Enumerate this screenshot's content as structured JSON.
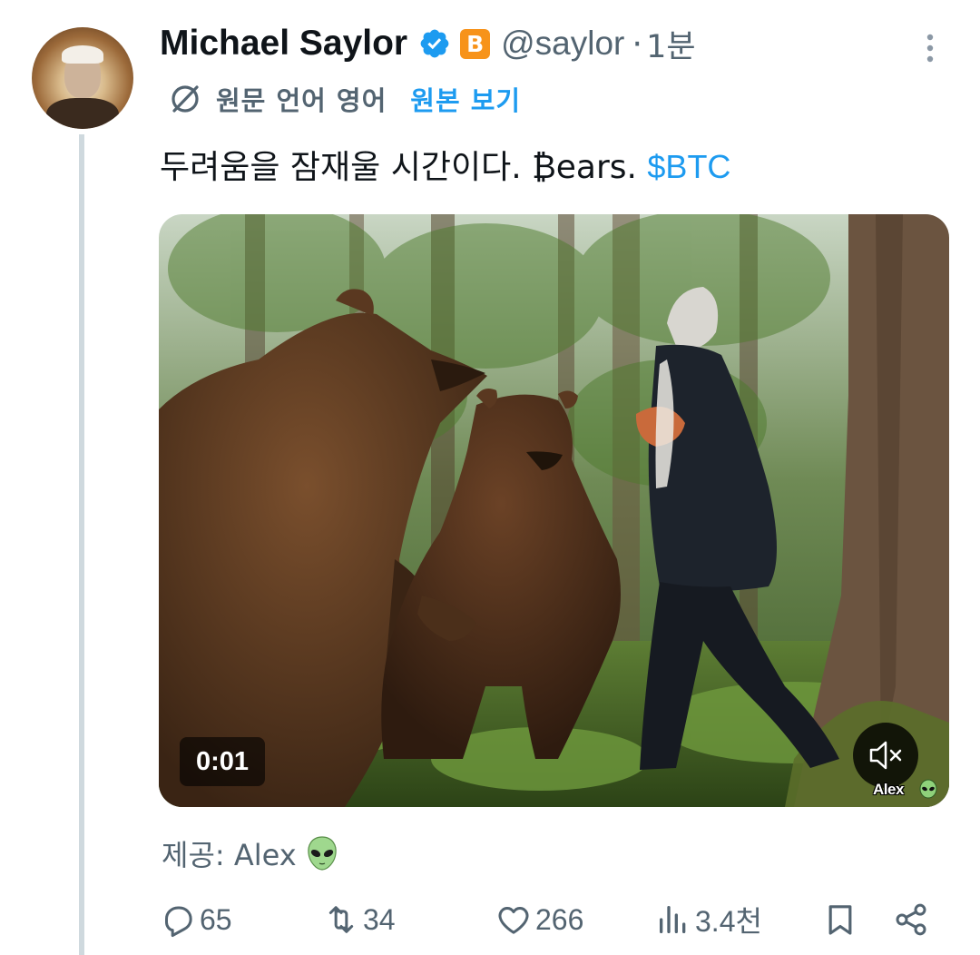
{
  "author": {
    "name": "Michael Saylor",
    "handle": "@saylor",
    "separator": "·",
    "time": "1분",
    "badge": "B"
  },
  "translation": {
    "label": "원문 언어 영어",
    "link": "원본 보기"
  },
  "tweet": {
    "text": "두려움을 잠재울 시간이다. ₿ears. ",
    "cashtag": "$BTC"
  },
  "media": {
    "timer": "0:01",
    "watermark": "Alex",
    "muted": true
  },
  "credit": {
    "text": "제공: Alex"
  },
  "actions": {
    "replies": "65",
    "reposts": "34",
    "likes": "266",
    "views": "3.4천"
  },
  "colors": {
    "link": "#1d9bf0",
    "secondary_text": "#536471",
    "verified": "#1d9bf0",
    "bitcoin_badge": "#f7931a"
  },
  "icons": {
    "more": "more-vertical-icon",
    "translate": "translate-icon",
    "verified": "verified-badge-icon",
    "reply": "reply-icon",
    "repost": "repost-icon",
    "like": "like-icon",
    "views": "views-icon",
    "bookmark": "bookmark-icon",
    "share": "share-icon",
    "mute": "mute-icon"
  }
}
